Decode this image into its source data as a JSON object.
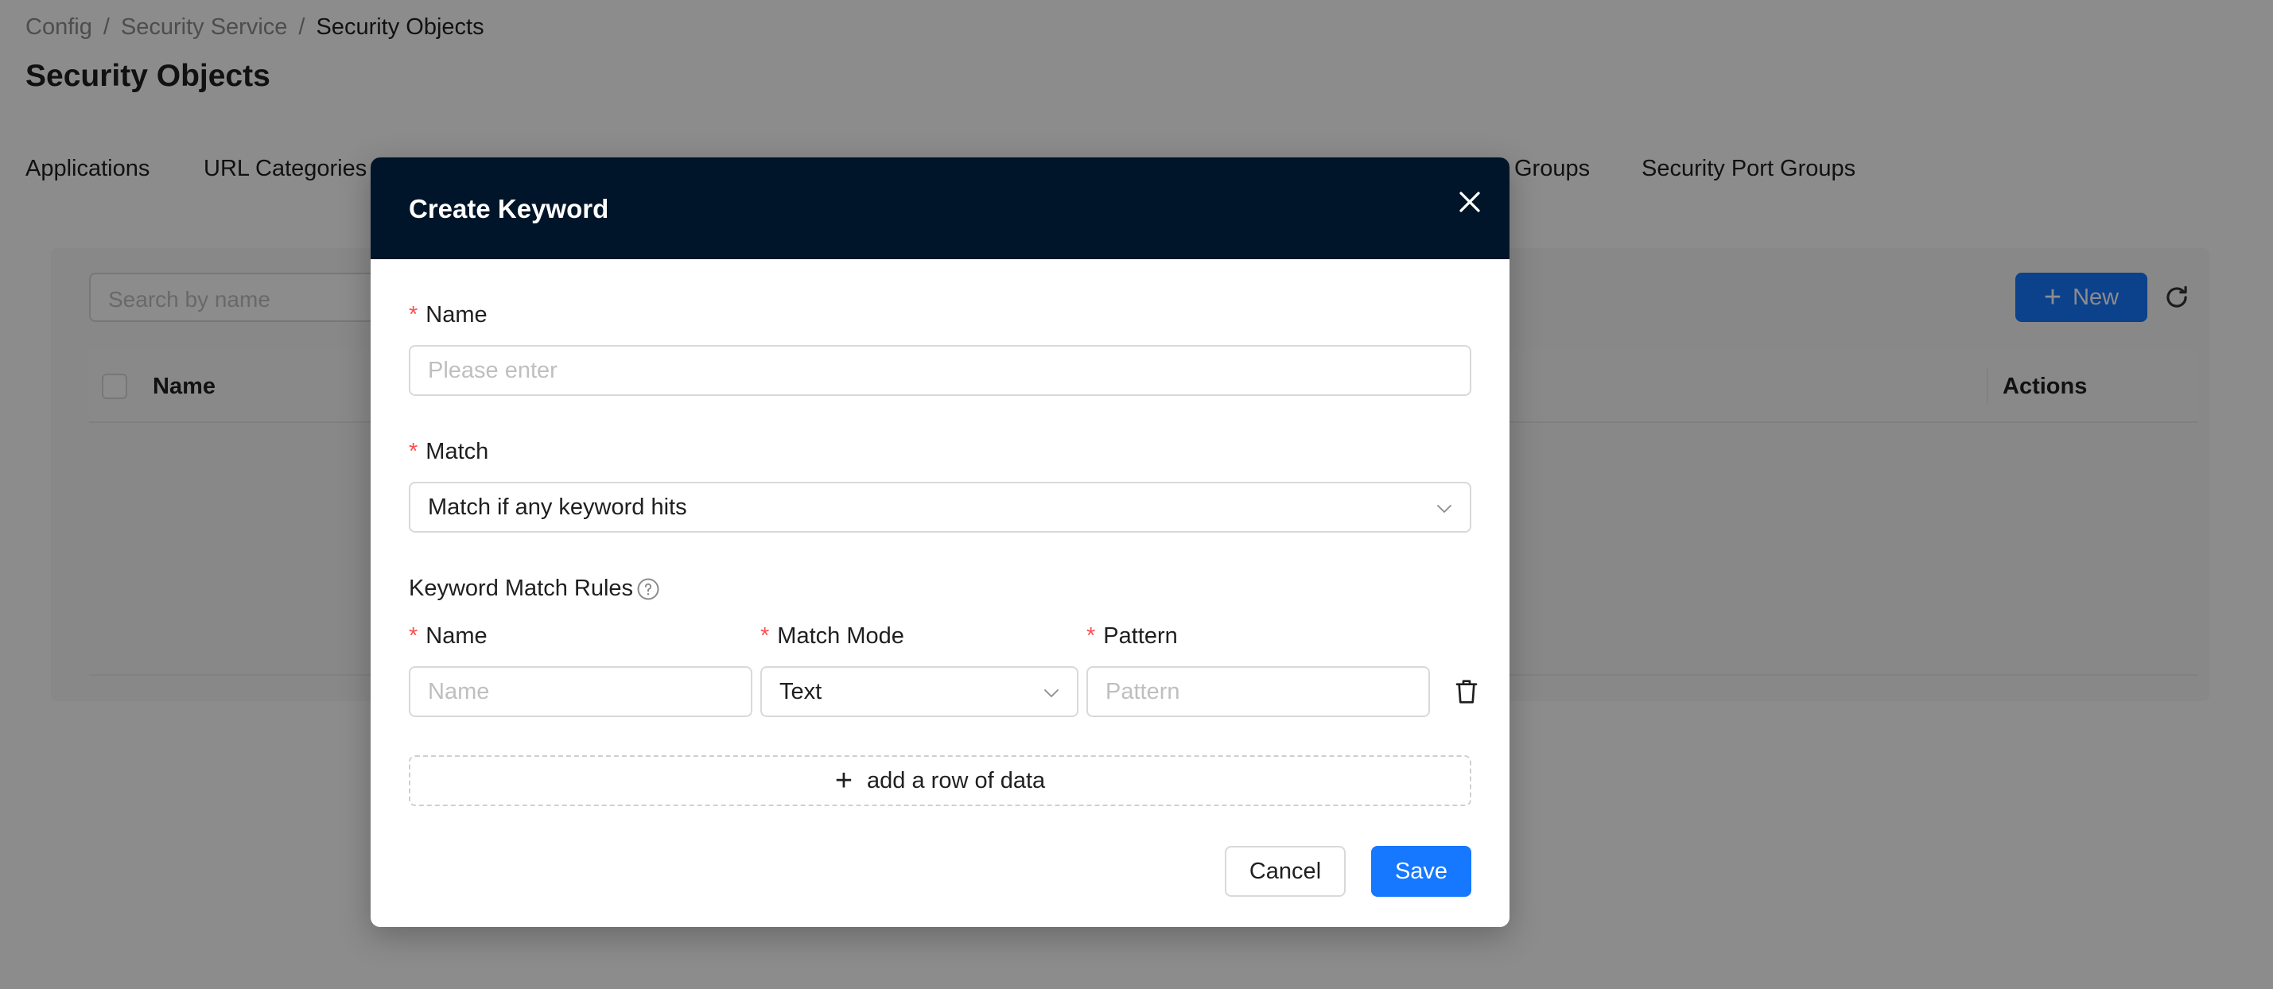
{
  "breadcrumb": {
    "items": [
      "Config",
      "Security Service",
      "Security Objects"
    ],
    "separator": "/"
  },
  "page": {
    "title": "Security Objects"
  },
  "tabs": {
    "visible": [
      "Applications",
      "URL Categories",
      "Groups",
      "Security Port Groups"
    ]
  },
  "toolbar": {
    "search_placeholder": "Search by name",
    "new_label": "New"
  },
  "table": {
    "columns": [
      "Name",
      "Actions"
    ]
  },
  "modal": {
    "title": "Create Keyword",
    "name": {
      "label": "Name",
      "placeholder": "Please enter"
    },
    "match": {
      "label": "Match",
      "value": "Match if any keyword hits"
    },
    "rules": {
      "title": "Keyword Match Rules",
      "columns": {
        "name": "Name",
        "match_mode": "Match Mode",
        "pattern": "Pattern"
      },
      "row": {
        "name_placeholder": "Name",
        "match_mode_value": "Text",
        "pattern_placeholder": "Pattern"
      },
      "add_row_label": "add a row of data"
    },
    "buttons": {
      "cancel": "Cancel",
      "save": "Save"
    }
  },
  "colors": {
    "primary": "#1677ff",
    "header_dark": "#001529",
    "required": "#ff4d4f",
    "overlay": "rgba(0,0,0,0.45)"
  }
}
